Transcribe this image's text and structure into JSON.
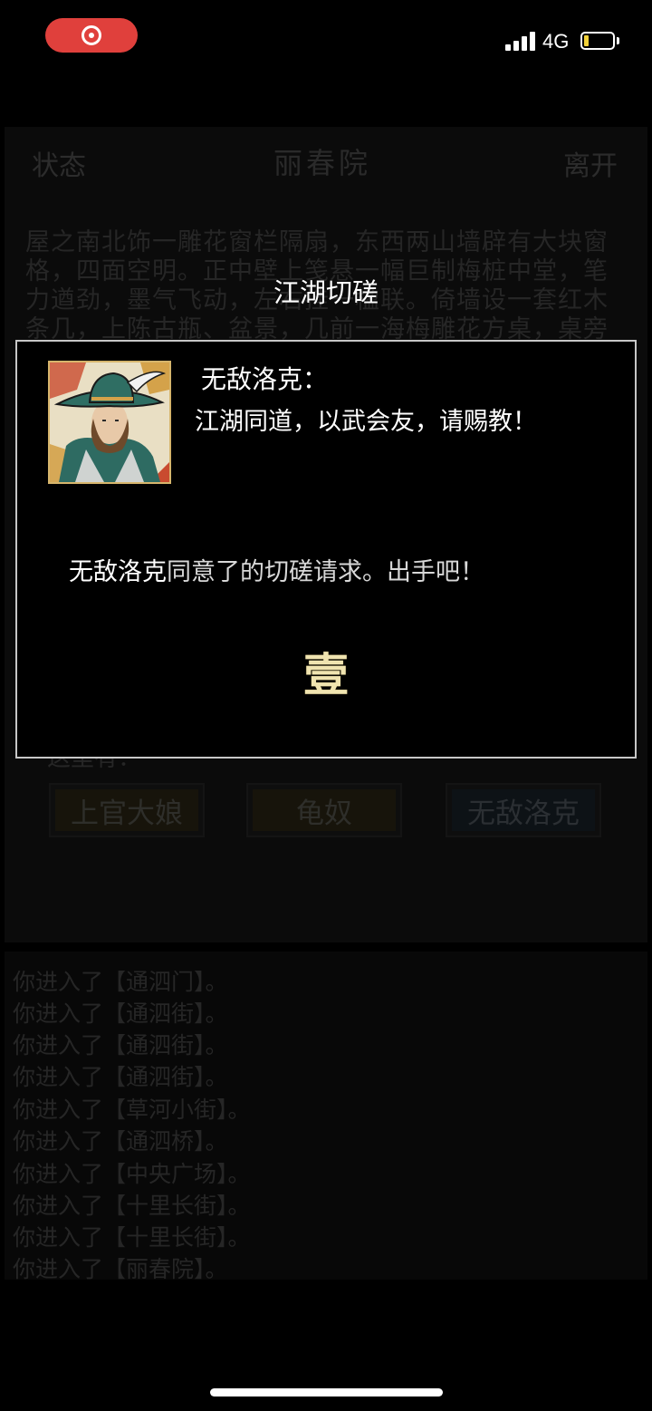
{
  "status_bar": {
    "network": "4G",
    "signal_bars": 4,
    "battery_level": 0.15,
    "icons": [
      "screen-record-icon",
      "signal-icon",
      "battery-icon"
    ]
  },
  "background": {
    "status_button": "状态",
    "location_title": "丽春院",
    "leave_button": "离开",
    "description_lines": [
      "屋之南北饰一雕花窗栏隔扇，东西两山墙辟有大块窗",
      "格，四面空明。正中壁上笺悬一幅巨制梅桩中堂，笔",
      "力遒劲，墨气飞动，左右挂一楹联。倚墙设一套红木",
      "条几，上陈古瓶、盆景，几前一海梅雕花方桌，桌旁"
    ],
    "here_label": "这里有：",
    "npcs": [
      "上官大娘",
      "龟奴",
      "无敌洛克"
    ],
    "log": [
      "你进入了【通泗门】。",
      "你进入了【通泗街】。",
      "你进入了【通泗街】。",
      "你进入了【通泗街】。",
      "你进入了【草河小街】。",
      "你进入了【通泗桥】。",
      "你进入了【中央广场】。",
      "你进入了【十里长街】。",
      "你进入了【十里长街】。",
      "你进入了【丽春院】。"
    ]
  },
  "dialog": {
    "title": "江湖切磋",
    "speaker": "无敌洛克：",
    "speech": "江湖同道，以武会友，请赐教！",
    "result_name": "无敌洛克",
    "result_text": "同意了的切磋请求。出手吧！",
    "countdown": "壹"
  },
  "colors": {
    "record_pill": "#e0403c",
    "dialog_border": "#c7c7c7",
    "countdown_text": "#f0e4b0",
    "avatar_frame": "#d6b56c"
  }
}
